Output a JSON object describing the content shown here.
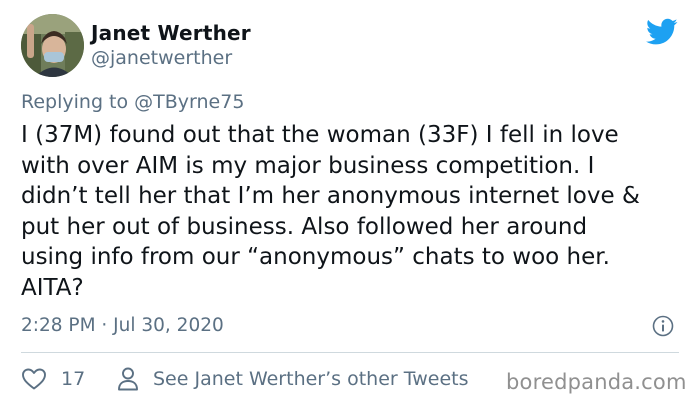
{
  "author": {
    "name": "Janet Werther",
    "handle": "@janetwerther"
  },
  "reply": {
    "prefix": "Replying to ",
    "mention": "@TByrne75"
  },
  "tweet": {
    "text": "I (37M) found out that the woman (33F) I fell in love\nwith over AIM is my major business competition. I\ndidn’t tell her that I’m her anonymous internet love &\nput her out of business. Also followed her around\nusing info from our “anonymous” chats to woo her.\nAITA?",
    "timestamp": "2:28 PM · Jul 30, 2020"
  },
  "actions": {
    "like_count": "17",
    "other_tweets_label": "See Janet Werther’s other Tweets"
  },
  "watermark": "boredpanda.com",
  "icons": {
    "brand": "twitter-bird-icon",
    "info": "info-icon",
    "like": "heart-icon",
    "profile": "person-icon"
  },
  "colors": {
    "twitter_blue": "#1da1f2",
    "secondary_text": "#5b7083",
    "primary_text": "#0f1419",
    "divider": "#cfd9de"
  }
}
